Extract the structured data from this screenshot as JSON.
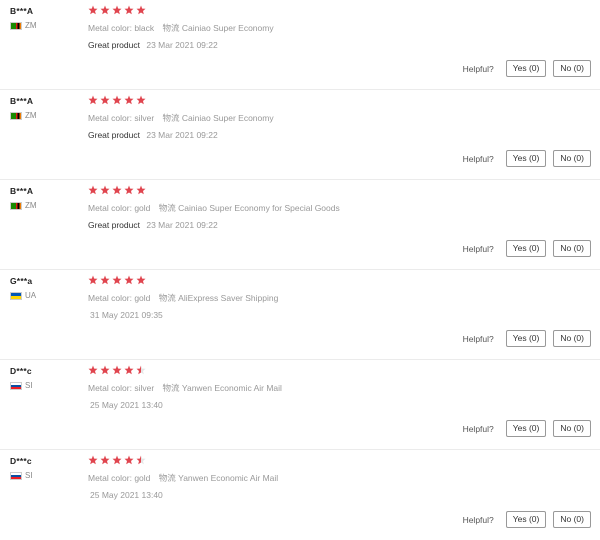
{
  "helpful_label": "Helpful?",
  "reviews": [
    {
      "name": "B***A",
      "country": "ZM",
      "flag": "zm",
      "rating": 5,
      "color_label": "Metal color:",
      "color_value": "black",
      "ship_label": "物流",
      "ship_value": "Cainiao Super Economy",
      "text": "Great product",
      "date": "23 Mar 2021 09:22",
      "yes": "Yes (0)",
      "no": "No (0)"
    },
    {
      "name": "B***A",
      "country": "ZM",
      "flag": "zm",
      "rating": 5,
      "color_label": "Metal color:",
      "color_value": "silver",
      "ship_label": "物流",
      "ship_value": "Cainiao Super Economy",
      "text": "Great product",
      "date": "23 Mar 2021 09:22",
      "yes": "Yes (0)",
      "no": "No (0)"
    },
    {
      "name": "B***A",
      "country": "ZM",
      "flag": "zm",
      "rating": 5,
      "color_label": "Metal color:",
      "color_value": "gold",
      "ship_label": "物流",
      "ship_value": "Cainiao Super Economy for Special Goods",
      "text": "Great product",
      "date": "23 Mar 2021 09:22",
      "yes": "Yes (0)",
      "no": "No (0)"
    },
    {
      "name": "G***a",
      "country": "UA",
      "flag": "ua",
      "rating": 5,
      "color_label": "Metal color:",
      "color_value": "gold",
      "ship_label": "物流",
      "ship_value": "AliExpress Saver Shipping",
      "text": "",
      "date": "31 May 2021 09:35",
      "yes": "Yes (0)",
      "no": "No (0)"
    },
    {
      "name": "D***c",
      "country": "SI",
      "flag": "si",
      "rating": 4.5,
      "color_label": "Metal color:",
      "color_value": "silver",
      "ship_label": "物流",
      "ship_value": "Yanwen Economic Air Mail",
      "text": "",
      "date": "25 May 2021 13:40",
      "yes": "Yes (0)",
      "no": "No (0)"
    },
    {
      "name": "D***c",
      "country": "SI",
      "flag": "si",
      "rating": 4.5,
      "color_label": "Metal color:",
      "color_value": "gold",
      "ship_label": "物流",
      "ship_value": "Yanwen Economic Air Mail",
      "text": "",
      "date": "25 May 2021 13:40",
      "yes": "Yes (0)",
      "no": "No (0)"
    }
  ],
  "colors": {
    "star": "#e0454f",
    "star_empty": "#e5e5e5"
  }
}
